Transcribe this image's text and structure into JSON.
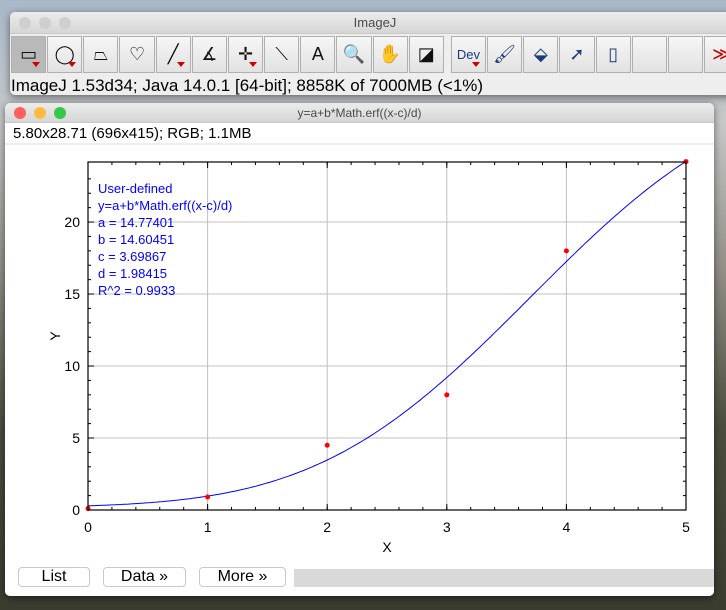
{
  "main_window": {
    "title": "ImageJ",
    "status": "ImageJ 1.53d34; Java 14.0.1 [64-bit]; 8858K of 7000MB (<1%)",
    "tools": [
      {
        "name": "rectangle-tool",
        "glyph": "▭",
        "selected": true,
        "menu": true
      },
      {
        "name": "oval-tool",
        "glyph": "◯",
        "menu": true
      },
      {
        "name": "polygon-tool",
        "glyph": "⏢"
      },
      {
        "name": "freehand-tool",
        "glyph": "♡"
      },
      {
        "name": "line-tool",
        "glyph": "╱",
        "menu": true
      },
      {
        "name": "angle-tool",
        "glyph": "∡"
      },
      {
        "name": "point-tool",
        "glyph": "✛",
        "menu": true
      },
      {
        "name": "wand-tool",
        "glyph": "⟍"
      },
      {
        "name": "text-tool",
        "glyph": "A"
      },
      {
        "name": "magnifier-tool",
        "glyph": "🔍"
      },
      {
        "name": "hand-tool",
        "glyph": "✋"
      },
      {
        "name": "color-picker-tool",
        "glyph": "◪"
      },
      {
        "name": "dev-menu",
        "glyph": "Dev",
        "menu": true,
        "gap": true
      },
      {
        "name": "brush-tool",
        "glyph": "🖌"
      },
      {
        "name": "fill-tool",
        "glyph": "⬙"
      },
      {
        "name": "arrow-tool",
        "glyph": "➚"
      },
      {
        "name": "spray-tool",
        "glyph": "▯"
      },
      {
        "name": "empty-slot",
        "glyph": ""
      },
      {
        "name": "empty-slot",
        "glyph": ""
      },
      {
        "name": "more-tools",
        "glyph": "≫"
      }
    ]
  },
  "plot_window": {
    "title": "y=a+b*Math.erf((x-c)/d)",
    "info": "5.80x28.71   (696x415); RGB; 1.1MB",
    "buttons": {
      "list": "List",
      "data": "Data »",
      "more": "More »"
    }
  },
  "chart_data": {
    "type": "scatter",
    "xlabel": "X",
    "ylabel": "Y",
    "xlim": [
      0,
      5
    ],
    "ylim": [
      0,
      24.17
    ],
    "xticks": [
      "0",
      "1",
      "2",
      "3",
      "4",
      "5"
    ],
    "yticks": [
      "0",
      "5",
      "10",
      "15",
      "20"
    ],
    "grid": true,
    "points": {
      "x": [
        0,
        1,
        2,
        3,
        4,
        5
      ],
      "y": [
        0.1,
        0.9,
        4.5,
        8.0,
        18.0,
        24.2
      ],
      "color": "#ff0000"
    },
    "fit": {
      "params": {
        "a": 14.77401,
        "b": 14.60451,
        "c": 3.69867,
        "d": 1.98415
      },
      "color": "#0000ff"
    },
    "legend": [
      "User-defined",
      "y=a+b*Math.erf((x-c)/d)",
      "a = 14.77401",
      "b = 14.60451",
      "c = 3.69867",
      "d = 1.98415",
      "R^2 = 0.9933"
    ]
  }
}
